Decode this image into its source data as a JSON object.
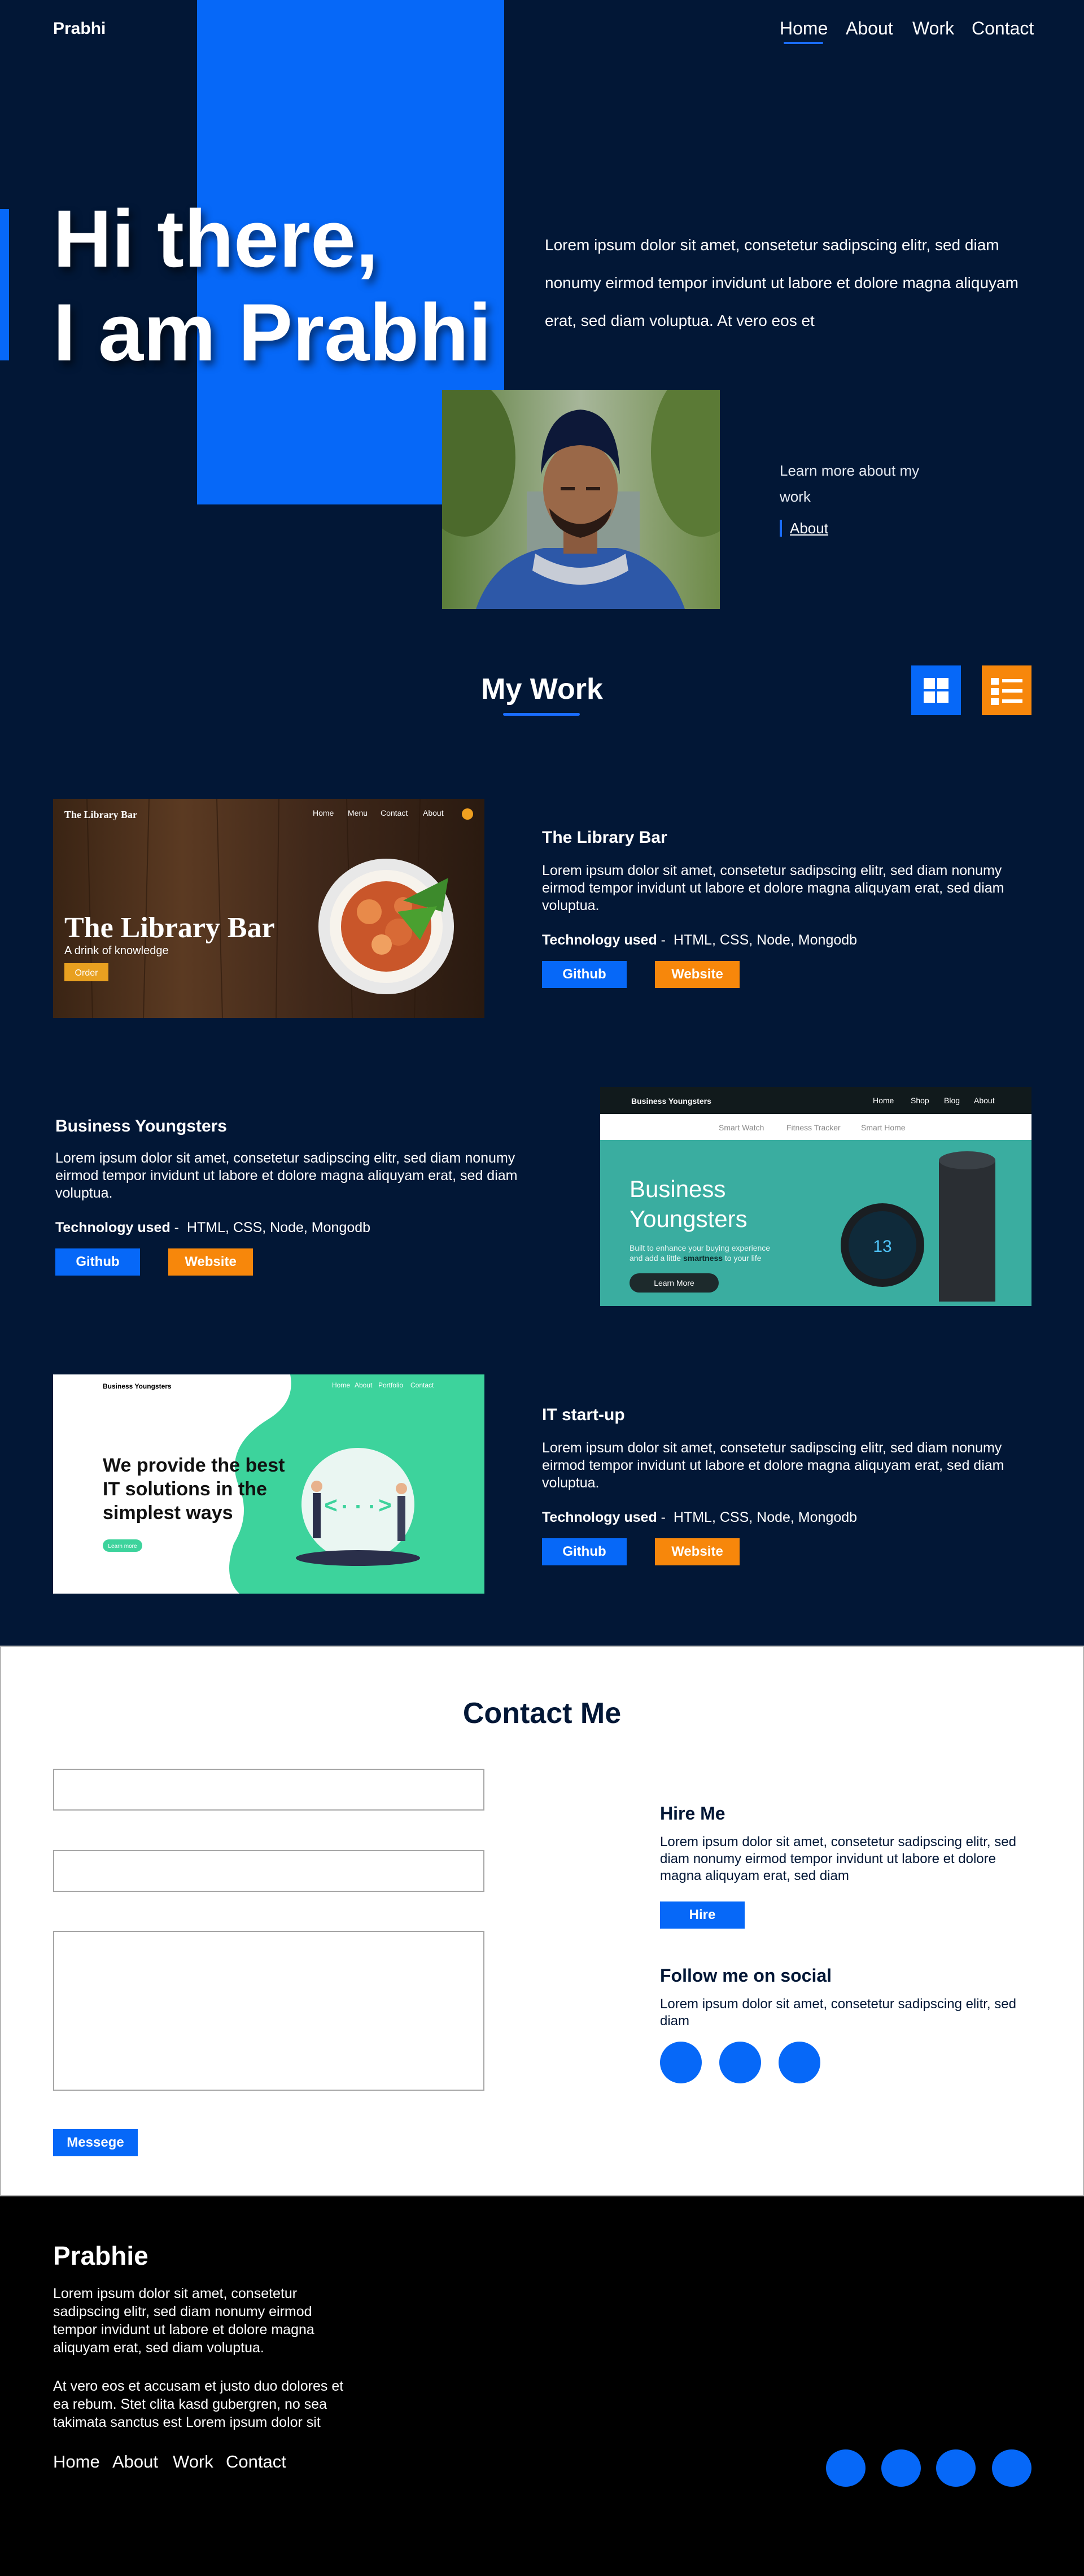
{
  "header": {
    "brand": "Prabhi",
    "nav": [
      "Home",
      "About",
      "Work",
      "Contact"
    ],
    "active": "Home"
  },
  "hero": {
    "title": "Hi there,\nI am Prabhi",
    "text": "Lorem ipsum dolor sit amet, consetetur sadipscing elitr, sed diam nonumy eirmod tempor invidunt ut labore et dolore magna aliquyam erat, sed diam voluptua. At vero eos et",
    "learn_more": "Learn more about my work",
    "about_link": "About"
  },
  "work": {
    "title": "My Work",
    "projects": [
      {
        "title": "The Library Bar",
        "desc": "Lorem ipsum dolor sit amet, consetetur sadipscing elitr, sed diam nonumy eirmod tempor invidunt ut labore et dolore magna aliquyam erat, sed diam voluptua.",
        "tech_label": "Technology used",
        "tech": "HTML, CSS, Node, Mongodb",
        "github": "Github",
        "website": "Website",
        "preview": {
          "brand": "The Library Bar",
          "nav": [
            "Home",
            "Menu",
            "Contact",
            "About"
          ],
          "heading": "The Library Bar",
          "tagline": "A drink of knowledge",
          "cta": "Order"
        }
      },
      {
        "title": "Business Youngsters",
        "desc": "Lorem ipsum dolor sit amet, consetetur sadipscing elitr, sed diam nonumy eirmod tempor invidunt ut labore et dolore magna aliquyam erat, sed diam voluptua.",
        "tech_label": "Technology used",
        "tech": "HTML, CSS, Node, Mongodb",
        "github": "Github",
        "website": "Website",
        "preview": {
          "brand": "Business Youngsters",
          "nav": [
            "Home",
            "Shop",
            "Blog",
            "About"
          ],
          "subnav": [
            "Smart Watch",
            "Fitness Tracker",
            "Smart Home"
          ],
          "heading1": "Business",
          "heading2": "Youngsters",
          "line1": "Built to enhance your buying experience",
          "line2a": "and add a little ",
          "line2b": "smartness",
          "line2c": " to your life",
          "cta": "Learn More",
          "watch_readout": "13"
        }
      },
      {
        "title": "IT start-up",
        "desc": "Lorem ipsum dolor sit amet, consetetur sadipscing elitr, sed diam nonumy eirmod tempor invidunt ut labore et dolore magna aliquyam erat, sed diam voluptua.",
        "tech_label": "Technology used",
        "tech": "HTML, CSS, Node, Mongodb",
        "github": "Github",
        "website": "Website",
        "preview": {
          "brand": "Business Youngsters",
          "nav": [
            "Home",
            "About",
            "Portfolio",
            "Contact"
          ],
          "heading": "We provide the best IT solutions in the simplest ways",
          "cta": "Learn more"
        }
      }
    ]
  },
  "contact": {
    "title": "Contact Me",
    "message_button": "Messege",
    "hire_title": "Hire Me",
    "hire_text": "Lorem ipsum dolor sit amet, consetetur sadipscing elitr, sed diam nonumy eirmod tempor invidunt ut labore et dolore magna aliquyam erat, sed diam",
    "hire_button": "Hire",
    "social_title": "Follow me on social",
    "social_text": "Lorem ipsum dolor sit amet, consetetur sadipscing elitr, sed diam"
  },
  "footer": {
    "brand": "Prabhie",
    "text1": "Lorem ipsum dolor sit amet, consetetur sadipscing elitr, sed diam nonumy eirmod tempor invidunt ut labore et dolore magna aliquyam erat, sed diam voluptua.",
    "text2": "At vero eos et accusam et justo duo dolores et ea rebum. Stet clita kasd gubergren, no sea takimata sanctus est Lorem ipsum dolor sit",
    "nav": [
      "Home",
      "About",
      "Work",
      "Contact"
    ]
  },
  "colors": {
    "background": "#021736",
    "accent_blue": "#0668f8",
    "accent_orange": "#f7870b",
    "footer": "#000000"
  }
}
